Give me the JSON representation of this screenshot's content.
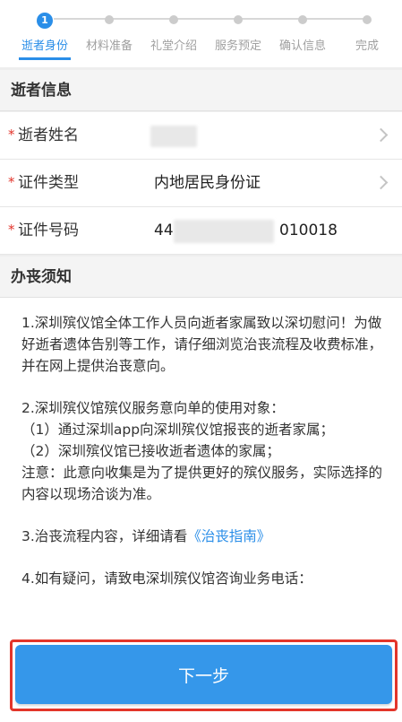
{
  "stepper": {
    "active_number": "1",
    "steps": [
      {
        "label": "逝者身份"
      },
      {
        "label": "材料准备"
      },
      {
        "label": "礼堂介绍"
      },
      {
        "label": "服务预定"
      },
      {
        "label": "确认信息"
      },
      {
        "label": "完成"
      }
    ]
  },
  "deceased_section": {
    "title": "逝者信息",
    "name": {
      "label": "逝者姓名",
      "value": ""
    },
    "id_type": {
      "label": "证件类型",
      "value": "内地居民身份证"
    },
    "id_number": {
      "label": "证件号码",
      "value_prefix": "44",
      "value_suffix": "010018"
    }
  },
  "notice_section": {
    "title": "办丧须知",
    "p1": "1.深圳殡仪馆全体工作人员向逝者家属致以深切慰问！为做好逝者遗体告别等工作，请仔细浏览治丧流程及收费标准，并在网上提供治丧意向。",
    "p2_line1": "2.深圳殡仪馆殡仪服务意向单的使用对象：",
    "p2_line2": "（1）通过深圳app向深圳殡仪馆报丧的逝者家属；",
    "p2_line3": "（2）深圳殡仪馆已接收逝者遗体的家属；",
    "p2_line4": "注意：此意向收集是为了提供更好的殡仪服务，实际选择的内容以现场洽谈为准。",
    "p3_text": "3.治丧流程内容，详细请看",
    "p3_link": "《治丧指南》",
    "p4": "4.如有疑问，请致电深圳殡仪馆咨询业务电话："
  },
  "footer": {
    "next_label": "下一步"
  },
  "colors": {
    "accent": "#2a8ee8",
    "button": "#3597ea",
    "required": "#e2342b",
    "highlight": "#e3352a"
  }
}
